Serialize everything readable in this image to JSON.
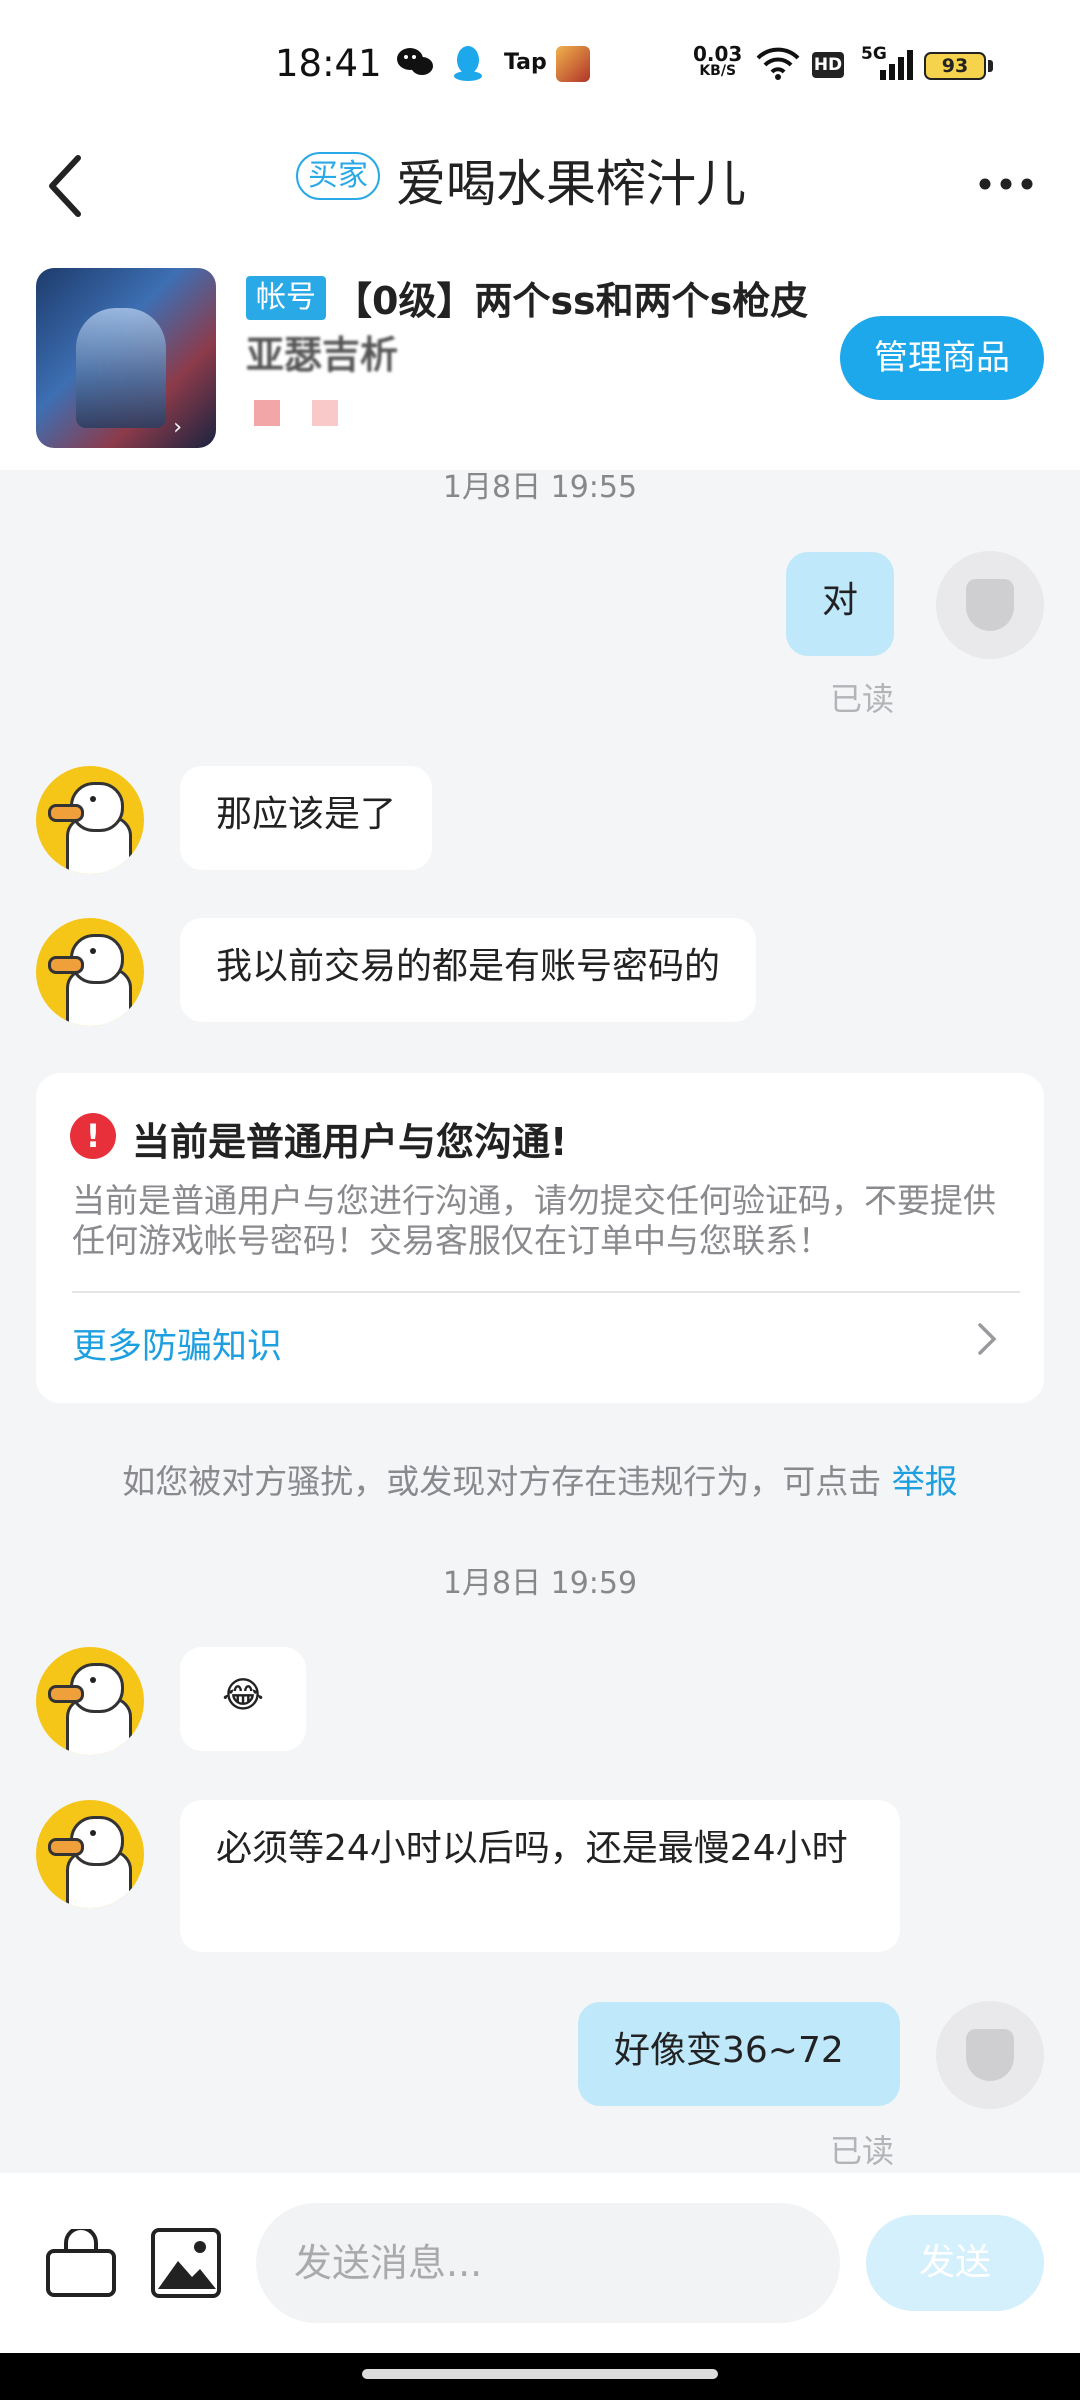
{
  "status_bar": {
    "time": "18:41",
    "app_icons": [
      "wechat-icon",
      "qq-icon",
      "taptap-icon",
      "game-icon"
    ],
    "tap_label": "Tap",
    "net_speed_value": "0.03",
    "net_speed_unit": "KB/S",
    "hd": "HD",
    "network": "5G",
    "battery": "93"
  },
  "header": {
    "role_badge": "买家",
    "title": "爱喝水果榨汁儿",
    "back_icon": "chevron-left-icon",
    "more_icon": "more-dots-icon"
  },
  "product": {
    "tag": "帐号",
    "title_line1": "【0级】两个ss和两个s枪皮",
    "title_line2": "亚瑟吉析",
    "manage_button": "管理商品"
  },
  "chat": {
    "timestamp_1": "1月8日  19:55",
    "msg_out_1": "对",
    "read_1": "已读",
    "msg_in_1": "那应该是了",
    "msg_in_2": "我以前交易的都是有账号密码的",
    "warning": {
      "title": "当前是普通用户与您沟通!",
      "body": "当前是普通用户与您进行沟通，请勿提交任何验证码，不要提供任何游戏帐号密码！交易客服仅在订单中与您联系！",
      "link": "更多防骗知识"
    },
    "report_text": "如您被对方骚扰，或发现对方存在违规行为，可点击",
    "report_link": "举报",
    "timestamp_2": "1月8日  19:59",
    "msg_in_3": "😂",
    "msg_in_4": "必须等24小时以后吗，还是最慢24小时",
    "msg_out_2": "好像变36~72",
    "read_2": "已读"
  },
  "input_bar": {
    "placeholder": "发送消息...",
    "send_button": "发送"
  },
  "colors": {
    "accent": "#1ea8ec",
    "bubble_out": "#bfe8fb",
    "warning_red": "#e8303b",
    "background": "#f4f5f7"
  }
}
